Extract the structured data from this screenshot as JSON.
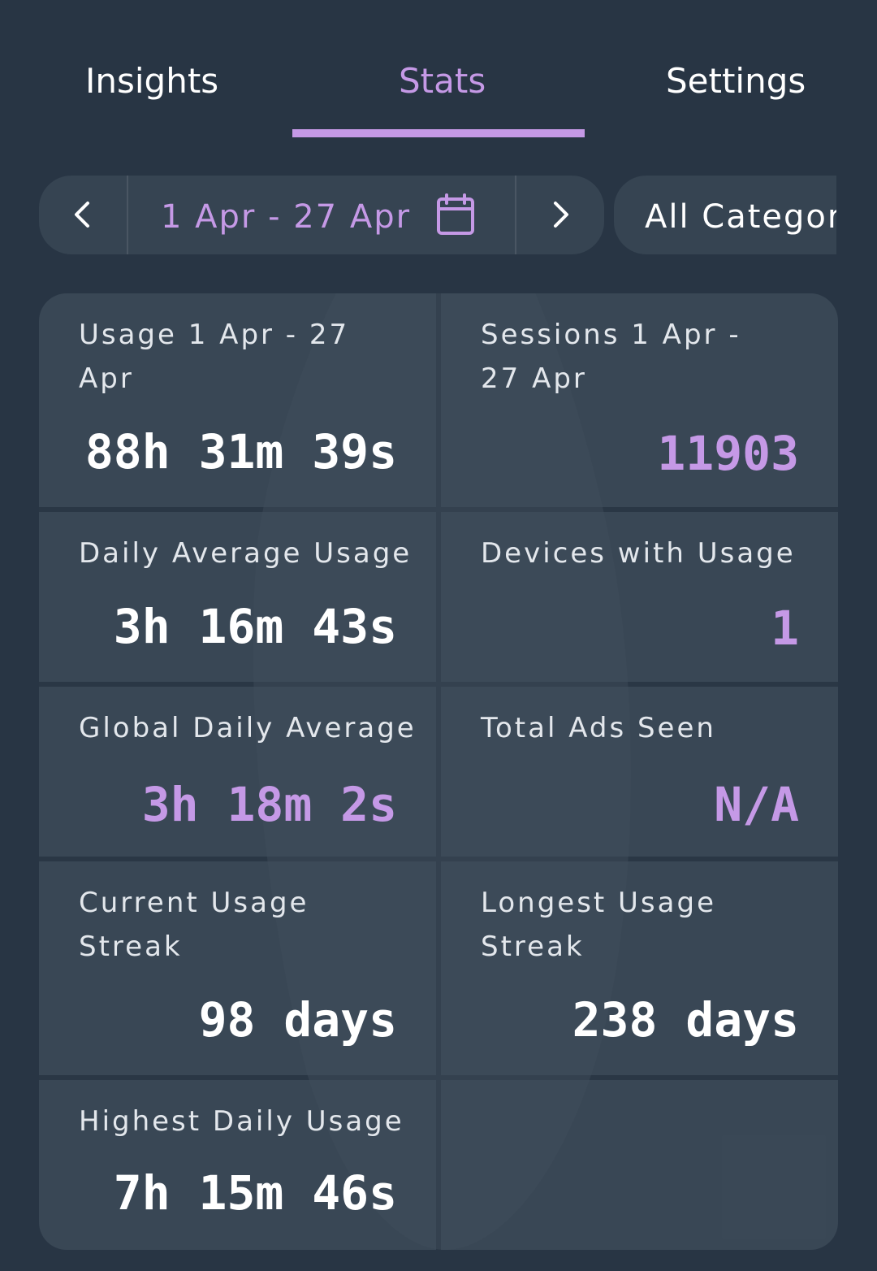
{
  "tabs": [
    {
      "label": "Insights",
      "active": false
    },
    {
      "label": "Stats",
      "active": true
    },
    {
      "label": "Settings",
      "active": false
    }
  ],
  "date_range": {
    "label": "1 Apr - 27 Apr",
    "prev_icon": "chevron-left-icon",
    "next_icon": "chevron-right-icon",
    "calendar_icon": "calendar-icon"
  },
  "category_filter": {
    "label": "All Categor"
  },
  "stats": [
    {
      "label": "Usage 1 Apr - 27 Apr",
      "value": "88h 31m 39s",
      "accent": false
    },
    {
      "label": "Sessions 1 Apr - 27 Apr",
      "value": "11903",
      "accent": true
    },
    {
      "label": "Daily Average Usage",
      "value": "3h 16m 43s",
      "accent": false
    },
    {
      "label": "Devices with Usage",
      "value": "1",
      "accent": true
    },
    {
      "label": "Global Daily Average",
      "value": "3h 18m 2s",
      "accent": true
    },
    {
      "label": "Total Ads Seen",
      "value": "N/A",
      "accent": true
    },
    {
      "label": "Current Usage Streak",
      "value": "98 days",
      "accent": false
    },
    {
      "label": "Longest Usage Streak",
      "value": "238 days",
      "accent": false
    },
    {
      "label": "Highest Daily Usage",
      "value": "7h 15m 46s",
      "accent": false
    },
    {
      "label": "",
      "value": "",
      "accent": false
    }
  ],
  "colors": {
    "background": "#283544",
    "accent": "#c599e6",
    "card": "#404e5c",
    "text": "#ffffff"
  }
}
